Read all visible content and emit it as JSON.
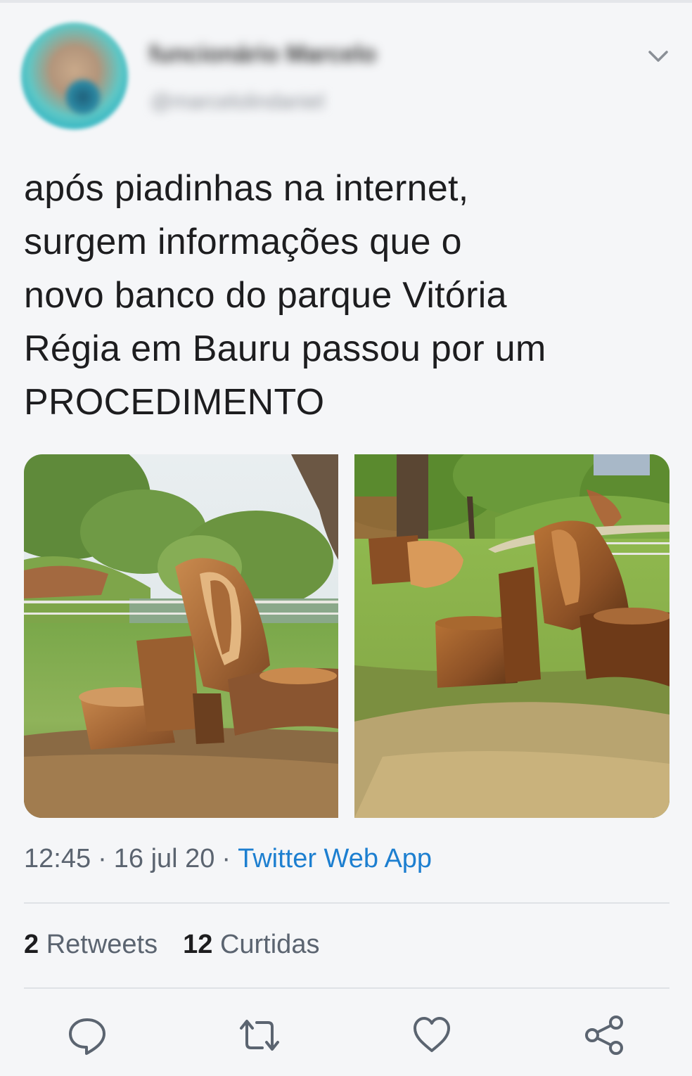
{
  "author": {
    "display_name": "funcionário Marcelo",
    "handle": "@marcelolindaniel"
  },
  "tweet": {
    "lines": [
      "após piadinhas na internet,",
      "surgem informações que o",
      "novo banco do parque Vitória",
      "Régia em Bauru passou por um",
      "PROCEDIMENTO"
    ]
  },
  "meta": {
    "time": "12:45",
    "separator": "·",
    "date": "16 jul 20",
    "source": "Twitter Web App"
  },
  "stats": {
    "retweets_count": "2",
    "retweets_label": "Retweets",
    "likes_count": "12",
    "likes_label": "Curtidas"
  },
  "icons": {
    "menu": "chevron-down-icon",
    "reply": "reply-icon",
    "retweet": "retweet-icon",
    "like": "heart-icon",
    "share": "share-icon"
  },
  "colors": {
    "accent": "#1d7fd0",
    "text": "#1d1d1f",
    "secondary": "#5b6470",
    "background": "#f5f6f8"
  }
}
